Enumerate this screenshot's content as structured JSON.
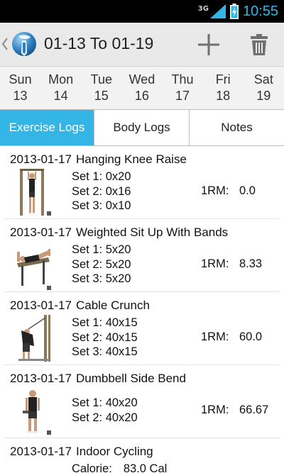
{
  "status_bar": {
    "network": "3G",
    "time": "10:55"
  },
  "action_bar": {
    "title": "01-13 To 01-19",
    "back_icon": "chevron-left-icon",
    "logo_icon": "app-logo-icon",
    "add_icon": "plus-icon",
    "delete_icon": "trash-icon"
  },
  "days": [
    {
      "name": "Sun",
      "num": "13"
    },
    {
      "name": "Mon",
      "num": "14"
    },
    {
      "name": "Tue",
      "num": "15"
    },
    {
      "name": "Wed",
      "num": "16"
    },
    {
      "name": "Thu",
      "num": "17"
    },
    {
      "name": "Fri",
      "num": "18"
    },
    {
      "name": "Sat",
      "num": "19"
    }
  ],
  "tabs": [
    {
      "label": "Exercise Logs",
      "active": true
    },
    {
      "label": "Body Logs",
      "active": false
    },
    {
      "label": "Notes",
      "active": false
    }
  ],
  "entries": [
    {
      "date": "2013-01-17",
      "name": "Hanging Knee Raise",
      "sets": [
        "Set 1: 0x20",
        "Set 2: 0x16",
        "Set 3: 0x10"
      ],
      "orm_label": "1RM:",
      "orm_value": "0.0"
    },
    {
      "date": "2013-01-17",
      "name": "Weighted Sit Up With Bands",
      "sets": [
        "Set 1: 5x20",
        "Set 2: 5x20",
        "Set 3: 5x20"
      ],
      "orm_label": "1RM:",
      "orm_value": "8.33"
    },
    {
      "date": "2013-01-17",
      "name": "Cable Crunch",
      "sets": [
        "Set 1: 40x15",
        "Set 2: 40x15",
        "Set 3: 40x15"
      ],
      "orm_label": "1RM:",
      "orm_value": "60.0"
    },
    {
      "date": "2013-01-17",
      "name": "Dumbbell Side Bend",
      "sets": [
        "Set 1: 40x20",
        "Set 2: 40x20"
      ],
      "orm_label": "1RM:",
      "orm_value": "66.67"
    },
    {
      "date": "2013-01-17",
      "name": "Indoor Cycling",
      "calorie_label": "Calorie:",
      "calorie_value": "83.0 Cal"
    }
  ],
  "colors": {
    "accent": "#33b5e5",
    "status_bar": "#000000",
    "action_bar": "#e9e9e9"
  }
}
